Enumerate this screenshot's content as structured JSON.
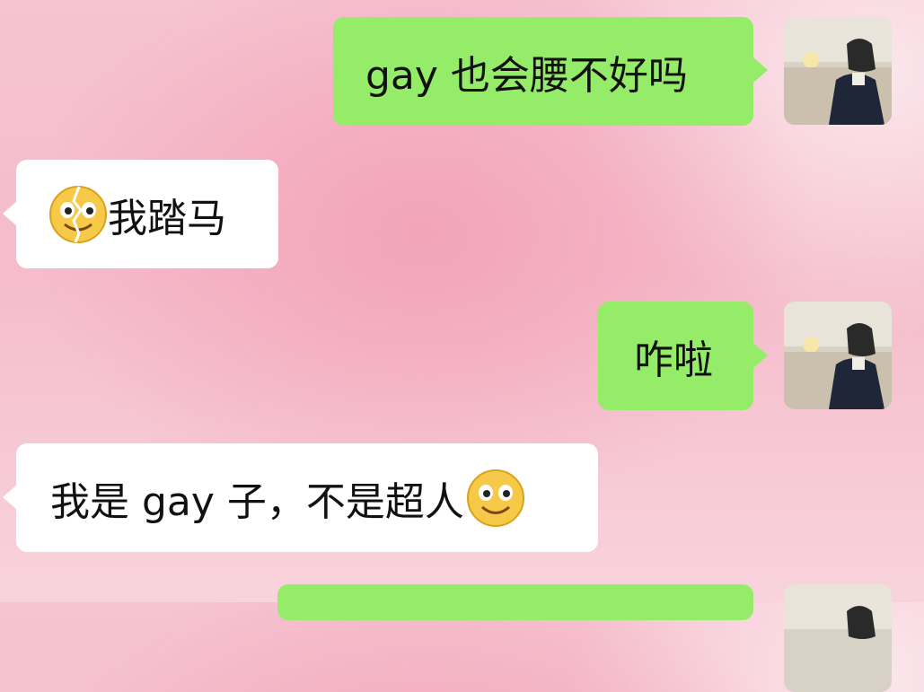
{
  "messages": [
    {
      "side": "out",
      "text": "gay 也会腰不好吗"
    },
    {
      "side": "in",
      "emoji": "cracked-smile-emoji",
      "text": "我踏马"
    },
    {
      "side": "out",
      "text": "咋啦"
    },
    {
      "side": "in",
      "text": "我是 gay 子，不是超人",
      "emoji": "smile-emoji"
    },
    {
      "side": "out",
      "text": ""
    }
  ],
  "colors": {
    "outgoing_bubble": "#95ec69",
    "incoming_bubble": "#ffffff",
    "background": "#f5bccb"
  }
}
